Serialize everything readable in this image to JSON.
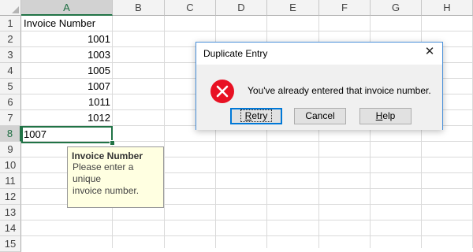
{
  "columns": [
    "A",
    "B",
    "C",
    "D",
    "E",
    "F",
    "G",
    "H"
  ],
  "rows": [
    "1",
    "2",
    "3",
    "4",
    "5",
    "6",
    "7",
    "8",
    "9",
    "10",
    "11",
    "12",
    "13",
    "14",
    "15"
  ],
  "cells": {
    "a1": "Invoice Number",
    "a2": "1001",
    "a3": "1003",
    "a4": "1005",
    "a5": "1007",
    "a6": "1011",
    "a7": "1012",
    "a8": "1007"
  },
  "tooltip": {
    "title": "Invoice Number",
    "line1": "Please enter a unique",
    "line2": "invoice number."
  },
  "dialog": {
    "title": "Duplicate Entry",
    "close_glyph": "✕",
    "message": "You've already entered that invoice number.",
    "retry_pre": "",
    "retry_mnemonic": "R",
    "retry_post": "etry",
    "cancel_label": "Cancel",
    "help_pre": "",
    "help_mnemonic": "H",
    "help_post": "elp"
  },
  "colors": {
    "selection_green": "#217346",
    "dialog_border": "#4a90d9",
    "error_red": "#e81123",
    "tooltip_bg": "#ffffe1"
  },
  "icons": {
    "error": "error-x-circle",
    "close": "close-x"
  }
}
